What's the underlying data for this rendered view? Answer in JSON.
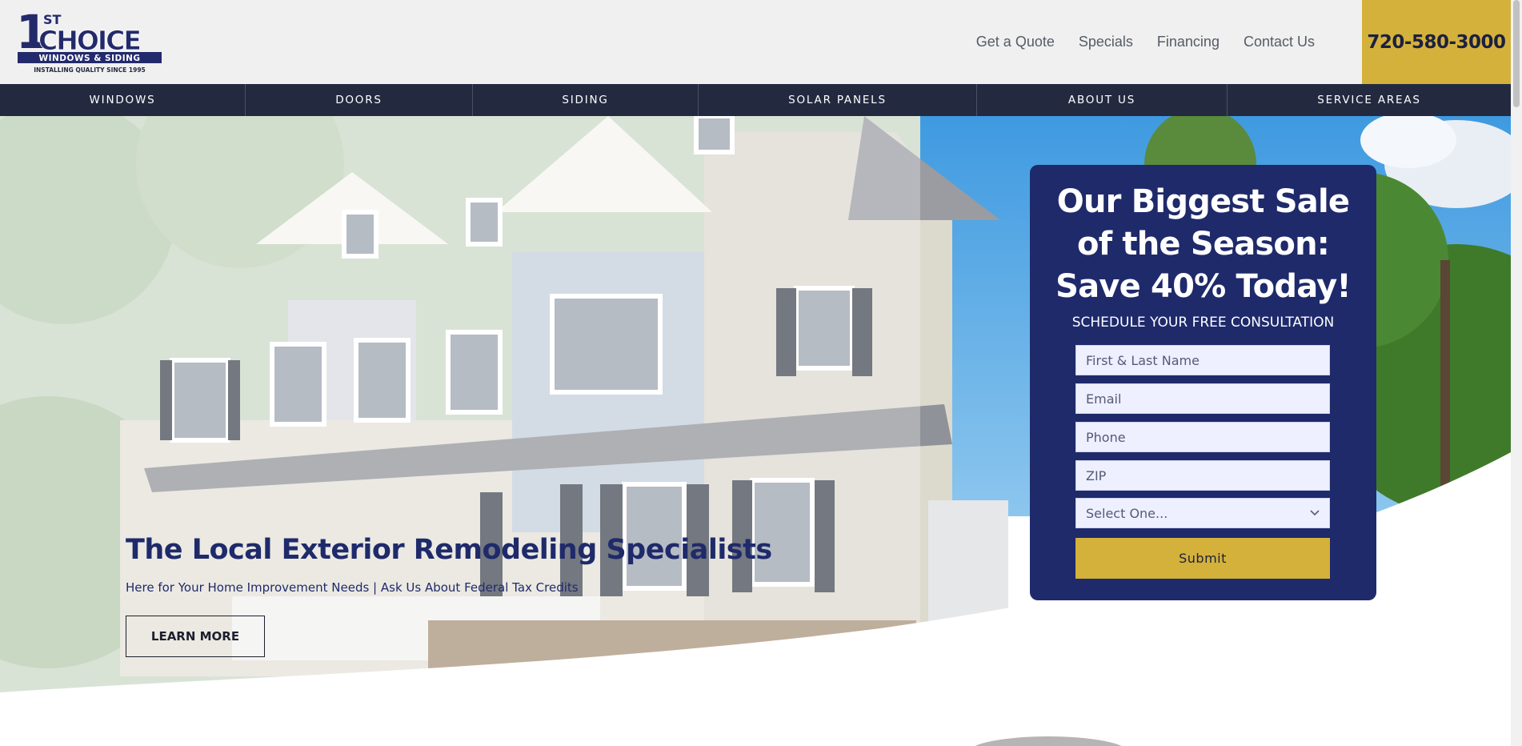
{
  "header": {
    "logo_text": {
      "line1_number": "1",
      "line1_super": "ST",
      "line1_word": "CHOICE",
      "line2": "WINDOWS & SIDING",
      "tagline": "INSTALLING QUALITY SINCE 1995"
    },
    "top_links": [
      {
        "label": "Get a Quote"
      },
      {
        "label": "Specials"
      },
      {
        "label": "Financing"
      },
      {
        "label": "Contact Us"
      }
    ],
    "phone": "720-580-3000"
  },
  "nav": {
    "items": [
      {
        "label": "WINDOWS"
      },
      {
        "label": "DOORS"
      },
      {
        "label": "SIDING"
      },
      {
        "label": "SOLAR PANELS"
      },
      {
        "label": "ABOUT US"
      },
      {
        "label": "SERVICE AREAS"
      }
    ]
  },
  "hero": {
    "title": "The Local Exterior Remodeling Specialists",
    "subtitle": "Here for Your Home Improvement Needs | Ask Us About Federal Tax Credits",
    "cta_label": "LEARN MORE"
  },
  "form": {
    "title_line1": "Our Biggest Sale",
    "title_line2": "of the Season:",
    "title_line3": "Save 40% Today!",
    "subtitle": "SCHEDULE YOUR FREE CONSULTATION",
    "name_placeholder": "First & Last Name",
    "email_placeholder": "Email",
    "phone_placeholder": "Phone",
    "zip_placeholder": "ZIP",
    "select_value": "Select One...",
    "submit_label": "Submit"
  },
  "colors": {
    "navy": "#1f2a6b",
    "nav_bg": "#232a40",
    "gold": "#d4b13a",
    "header_bg": "#f0f0f0"
  }
}
